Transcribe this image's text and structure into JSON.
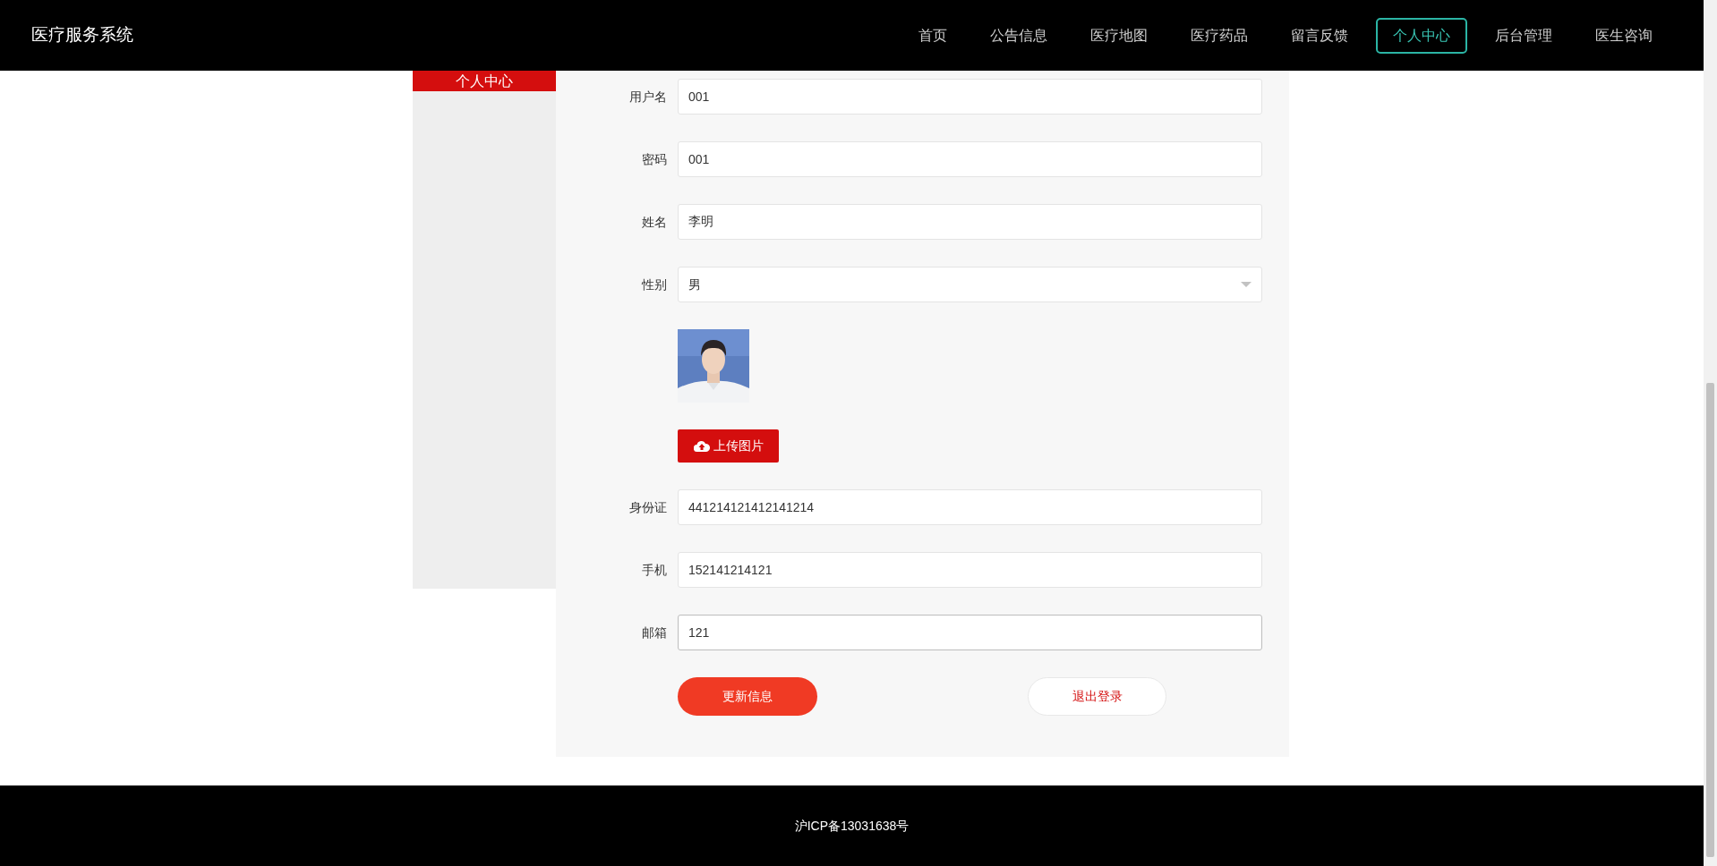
{
  "header": {
    "brand": "医疗服务系统",
    "nav": [
      {
        "label": "首页",
        "selected": false
      },
      {
        "label": "公告信息",
        "selected": false
      },
      {
        "label": "医疗地图",
        "selected": false
      },
      {
        "label": "医疗药品",
        "selected": false
      },
      {
        "label": "留言反馈",
        "selected": false
      },
      {
        "label": "个人中心",
        "selected": true
      },
      {
        "label": "后台管理",
        "selected": false
      },
      {
        "label": "医生咨询",
        "selected": false
      }
    ]
  },
  "sidebar": {
    "items": [
      {
        "label": "个人中心",
        "selected": true
      }
    ]
  },
  "form": {
    "fields": [
      {
        "kind": "text",
        "label": "用户名",
        "value": "001",
        "focused": false
      },
      {
        "kind": "text",
        "label": "密码",
        "value": "001",
        "focused": false
      },
      {
        "kind": "text",
        "label": "姓名",
        "value": "李明",
        "focused": false
      },
      {
        "kind": "select",
        "label": "性别",
        "value": "男"
      },
      {
        "kind": "picture"
      },
      {
        "kind": "upload",
        "label": "上传图片"
      },
      {
        "kind": "text",
        "label": "身份证",
        "value": "441214121412141214",
        "focused": false
      },
      {
        "kind": "text",
        "label": "手机",
        "value": "152141214121",
        "focused": false
      },
      {
        "kind": "text",
        "label": "邮箱",
        "value": "121",
        "focused": true
      }
    ],
    "actions": [
      {
        "kind": "primary",
        "label": "更新信息"
      },
      {
        "kind": "secondary",
        "label": "退出登录"
      }
    ]
  },
  "footer": {
    "text": "沪ICP备13031638号"
  }
}
